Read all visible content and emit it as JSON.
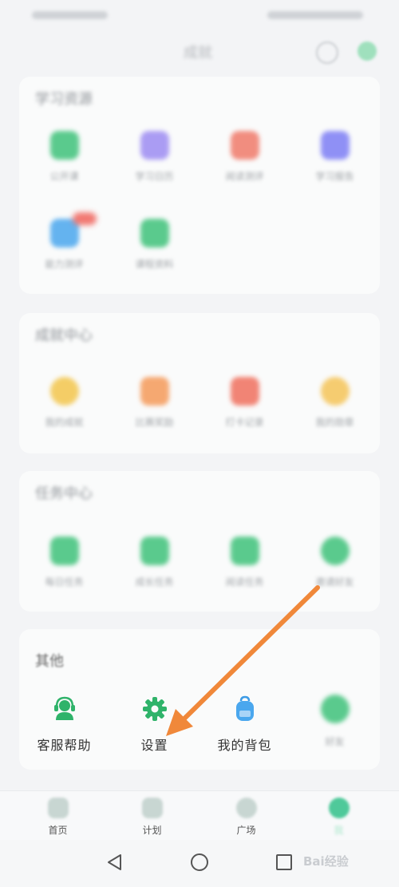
{
  "topbar": {
    "title": "成就"
  },
  "sections": [
    {
      "title": "学习资源",
      "items": [
        {
          "label": "公开课",
          "icon": "book-icon",
          "color": "#3fc27a"
        },
        {
          "label": "学习日历",
          "icon": "calendar-icon",
          "color": "#9d8cf2"
        },
        {
          "label": "阅读测评",
          "icon": "document-icon",
          "color": "#f07a6a"
        },
        {
          "label": "学习报告",
          "icon": "report-icon",
          "color": "#7d7ef5"
        },
        {
          "label": "能力测评",
          "icon": "tv-icon",
          "color": "#4aa7ee",
          "badge": true
        },
        {
          "label": "课程资料",
          "icon": "folder-icon",
          "color": "#3fc27a"
        }
      ]
    },
    {
      "title": "成就中心",
      "items": [
        {
          "label": "我的成就",
          "icon": "star-icon",
          "color": "#f3c64d"
        },
        {
          "label": "比赛奖励",
          "icon": "trophy-icon",
          "color": "#f59a5a"
        },
        {
          "label": "打卡记录",
          "icon": "calendar-check-icon",
          "color": "#f0705e"
        },
        {
          "label": "我的勋章",
          "icon": "medal-icon",
          "color": "#f5c458"
        }
      ]
    },
    {
      "title": "任务中心",
      "items": [
        {
          "label": "每日任务",
          "icon": "task-icon",
          "color": "#3fc27a"
        },
        {
          "label": "成长任务",
          "icon": "growth-icon",
          "color": "#3fc27a"
        },
        {
          "label": "阅读任务",
          "icon": "reading-icon",
          "color": "#3fc27a"
        },
        {
          "label": "邀请好友",
          "icon": "invite-icon",
          "color": "#3fc27a"
        }
      ]
    }
  ],
  "other": {
    "title": "其他",
    "items": [
      {
        "label": "客服帮助",
        "icon": "headset-icon",
        "color": "#3fc27a"
      },
      {
        "label": "设置",
        "icon": "gear-icon",
        "color": "#3fc27a"
      },
      {
        "label": "我的背包",
        "icon": "backpack-icon",
        "color": "#4aa7ee"
      },
      {
        "label": "好友",
        "icon": "friends-icon",
        "color": "#3fc27a"
      }
    ]
  },
  "tabs": [
    {
      "label": "首页",
      "icon": "play-icon"
    },
    {
      "label": "计划",
      "icon": "book-open-icon"
    },
    {
      "label": "广场",
      "icon": "planet-icon"
    },
    {
      "label": "我",
      "icon": "profile-icon"
    }
  ],
  "watermark": "Bai经验"
}
